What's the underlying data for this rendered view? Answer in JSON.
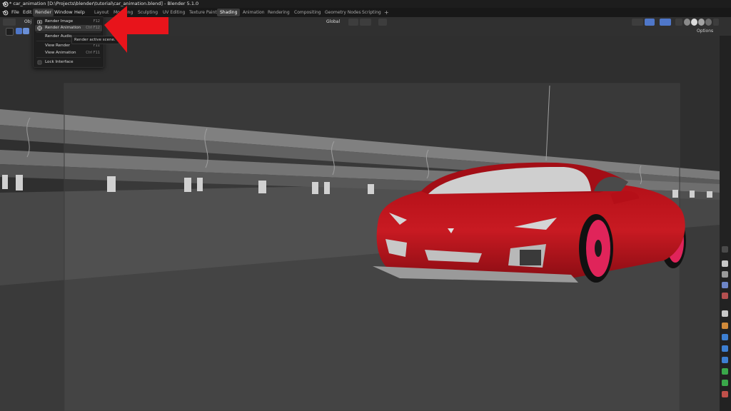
{
  "window": {
    "title": "* car_animation [D:\\Projects\\blender\\tutorial\\car_animation.blend] - Blender 5.1.0"
  },
  "menubar": {
    "items": [
      "File",
      "Edit",
      "Render",
      "Window",
      "Help"
    ],
    "workspaces": [
      "Layout",
      "Modeling",
      "Sculpting",
      "UV Editing",
      "Texture Paint",
      "Shading",
      "Animation",
      "Rendering",
      "Compositing",
      "Geometry Nodes",
      "Scripting"
    ],
    "active_workspace": "Shading",
    "add_tab": "+"
  },
  "header": {
    "mode_label": "Obj",
    "orientation": "Global",
    "options_label": "Options"
  },
  "render_menu": {
    "items": [
      {
        "label": "Render Image",
        "shortcut": "F12",
        "icon": "camera-icon"
      },
      {
        "label": "Render Animation",
        "shortcut": "Ctrl F12",
        "icon": "film-icon",
        "highlighted": true
      },
      {
        "label": "Render Audio",
        "shortcut": "",
        "icon": ""
      },
      {
        "label": "View Render",
        "shortcut": "F11",
        "icon": ""
      },
      {
        "label": "View Animation",
        "shortcut": "Ctrl F11",
        "icon": ""
      },
      {
        "label": "Lock Interface",
        "shortcut": "",
        "icon": "checkbox-icon"
      }
    ],
    "tooltip": "Render active scene."
  },
  "colors": {
    "car_body": "#c4121b",
    "car_rims": "#e0245a",
    "pointer_arrow": "#e8141b",
    "highlight": "#3a3a3a"
  }
}
